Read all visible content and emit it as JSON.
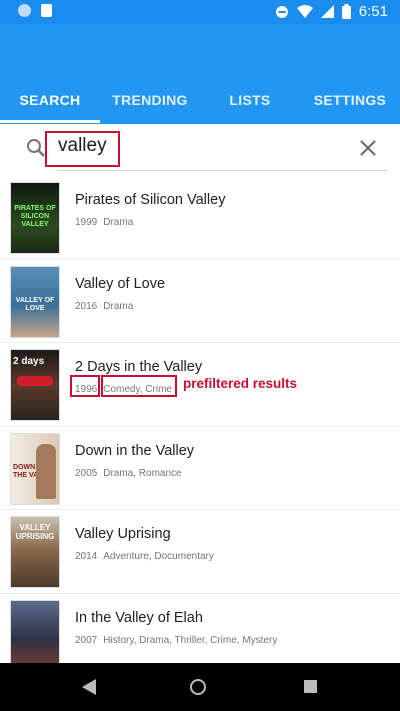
{
  "status_bar": {
    "time": "6:51"
  },
  "tabs": [
    {
      "label": "SEARCH",
      "active": true
    },
    {
      "label": "TRENDING",
      "active": false
    },
    {
      "label": "LISTS",
      "active": false
    },
    {
      "label": "SETTINGS",
      "active": false
    }
  ],
  "search": {
    "query": "valley"
  },
  "results": [
    {
      "title": "Pirates of Silicon Valley",
      "year": "1999",
      "genres": "Drama",
      "poster_text": "PIRATES OF SILICON VALLEY",
      "poster_color": "#1b2b1a"
    },
    {
      "title": "Valley of Love",
      "year": "2016",
      "genres": "Drama",
      "poster_text": "VALLEY OF LOVE",
      "poster_color": "#3a6f9a"
    },
    {
      "title": "2 Days in the Valley",
      "year": "1996",
      "genres": "Comedy, Crime",
      "poster_text": "2 days",
      "poster_color": "#2a2320"
    },
    {
      "title": "Down in the Valley",
      "year": "2005",
      "genres": "Drama, Romance",
      "poster_text": "DOWN IN THE VALLEY",
      "poster_color": "#e9e2d8"
    },
    {
      "title": "Valley Uprising",
      "year": "2014",
      "genres": "Adventure, Documentary",
      "poster_text": "VALLEY UPRISING",
      "poster_color": "#6b5440"
    },
    {
      "title": "In the Valley of Elah",
      "year": "2007",
      "genres": "History, Drama, Thriller, Crime, Mystery",
      "poster_text": "",
      "poster_color": "#3b3f52"
    }
  ],
  "annotation": {
    "label": "prefiltered results",
    "color": "#c8102e"
  },
  "colors": {
    "app_bar": "#2196F3",
    "status_bar": "#1a8cf0"
  }
}
